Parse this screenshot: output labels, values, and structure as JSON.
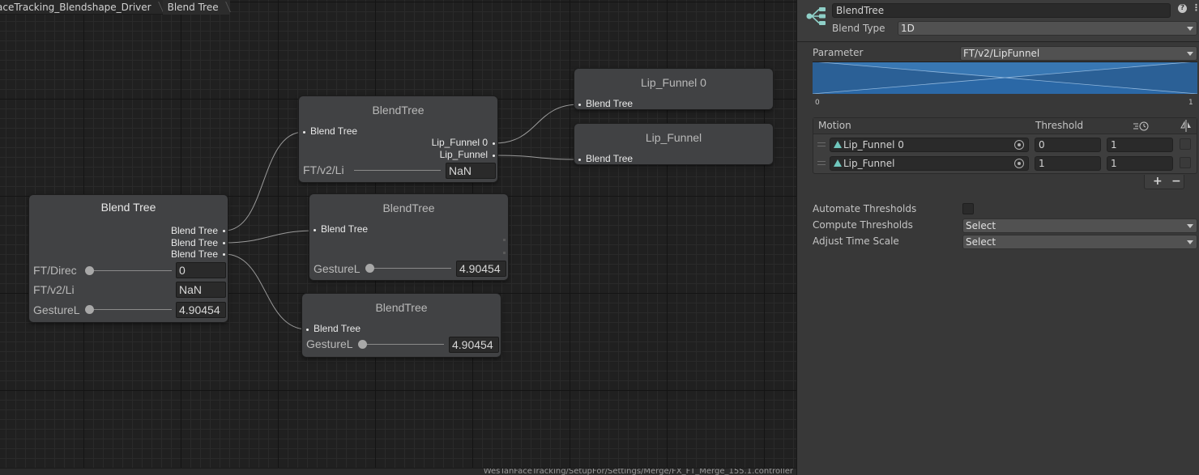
{
  "breadcrumb": {
    "items": [
      "aceTracking_Blendshape_Driver",
      "Blend Tree"
    ]
  },
  "graph": {
    "root_node": {
      "title": "Blend Tree",
      "outputs": [
        "Blend Tree",
        "Blend Tree",
        "Blend Tree"
      ],
      "params": [
        {
          "label": "FT/Direc",
          "value": "0",
          "has_slider": true
        },
        {
          "label": "FT/v2/Li",
          "value": "NaN",
          "has_slider": false
        },
        {
          "label": "GestureL",
          "value": "4.90454",
          "has_slider": true
        }
      ]
    },
    "node_a": {
      "title": "BlendTree",
      "input": "Blend Tree",
      "outputs": [
        "Lip_Funnel 0",
        "Lip_Funnel"
      ],
      "param": {
        "label": "FT/v2/Li",
        "value": "NaN"
      }
    },
    "node_b": {
      "title": "BlendTree",
      "input": "Blend Tree",
      "param": {
        "label": "GestureL",
        "value": "4.90454"
      }
    },
    "node_c": {
      "title": "BlendTree",
      "input": "Blend Tree",
      "param": {
        "label": "GestureL",
        "value": "4.90454"
      }
    },
    "clip_1": {
      "title": "Lip_Funnel 0",
      "input": "Blend Tree"
    },
    "clip_2": {
      "title": "Lip_Funnel",
      "input": "Blend Tree"
    }
  },
  "statusbar": {
    "path": "WesTanFaceTracking/SetupFor/Settings/Merge/FX_FT_Merge_155.1.controller"
  },
  "inspector": {
    "name": "BlendTree",
    "blend_type_label": "Blend Type",
    "blend_type_value": "1D",
    "parameter_label": "Parameter",
    "parameter_value": "FT/v2/LipFunnel",
    "graph_min": "0",
    "graph_max": "1",
    "motion_header": {
      "motion": "Motion",
      "threshold": "Threshold"
    },
    "motions": [
      {
        "name": "Lip_Funnel 0",
        "threshold": "0",
        "speed": "1"
      },
      {
        "name": "Lip_Funnel",
        "threshold": "1",
        "speed": "1"
      }
    ],
    "add_button": "+",
    "remove_button": "−",
    "automate_thresholds_label": "Automate Thresholds",
    "compute_thresholds_label": "Compute Thresholds",
    "compute_thresholds_value": "Select",
    "adjust_time_scale_label": "Adjust Time Scale",
    "adjust_time_scale_value": "Select",
    "help_icon": "?",
    "menu_icon": "⋮"
  },
  "colors": {
    "graph_bg": "#202020",
    "node_bg": "#414244",
    "inspector_bg": "#383838",
    "blend_blue": "#2f6fb0"
  }
}
